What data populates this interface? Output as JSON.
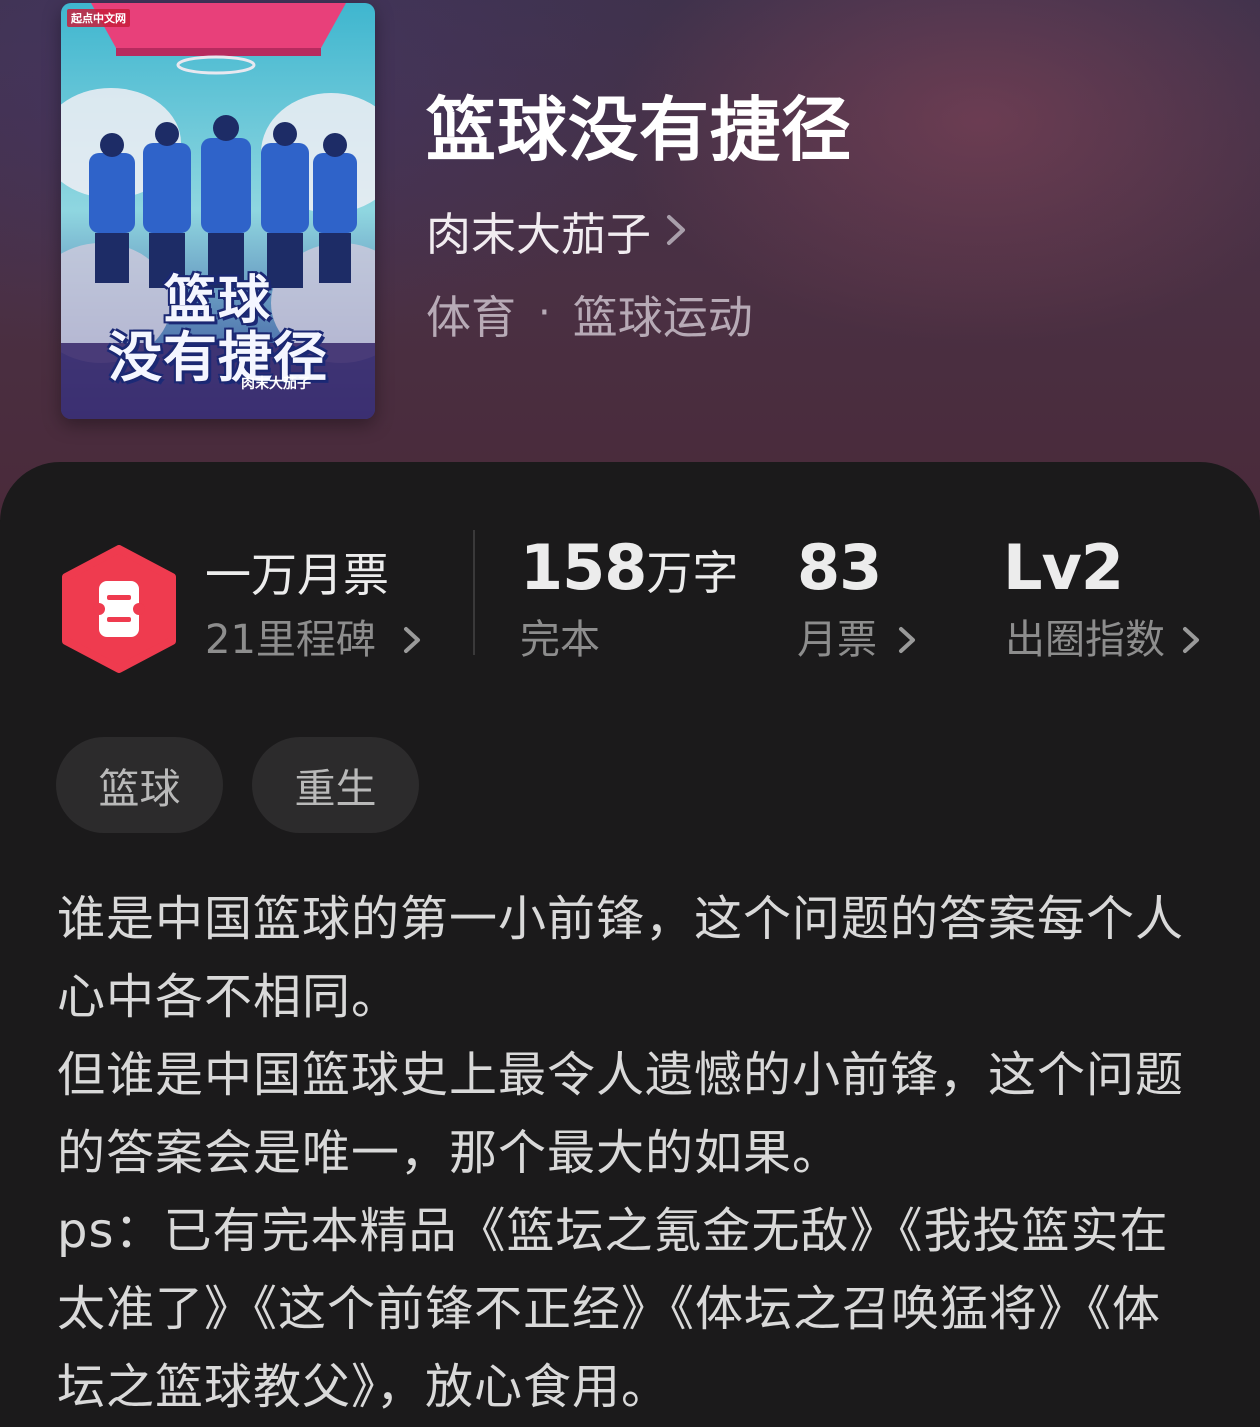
{
  "cover": {
    "brand": "起点中文网",
    "title_line1": "篮球",
    "title_line2": "没有捷径",
    "author": "肉末大茄子"
  },
  "book": {
    "title": "篮球没有捷径",
    "author": "肉末大茄子",
    "category": "体育",
    "separator": "·",
    "subcategory": "篮球运动"
  },
  "stats": {
    "monthly_ticket_badge": {
      "title": "一万月票",
      "sub": "21里程碑"
    },
    "word_count": {
      "value": "158",
      "unit": "万字",
      "label": "完本"
    },
    "monthly_tickets": {
      "value": "83",
      "label": "月票"
    },
    "popularity": {
      "value": "Lv2",
      "label": "出圈指数"
    }
  },
  "tags": [
    "篮球",
    "重生"
  ],
  "description": [
    "谁是中国篮球的第一小前锋，这个问题的答案每个人心中各不相同。",
    "但谁是中国篮球史上最令人遗憾的小前锋，这个问题的答案会是唯一，那个最大的如果。",
    "ps：已有完本精品《篮坛之氪金无敌》《我投篮实在太准了》《这个前锋不正经》《体坛之召唤猛将》《体坛之篮球教父》，放心食用。"
  ],
  "colors": {
    "badge_red": "#ef3b4f",
    "panel_bg": "#1b1a1b",
    "tag_bg": "#2c2b2c"
  }
}
